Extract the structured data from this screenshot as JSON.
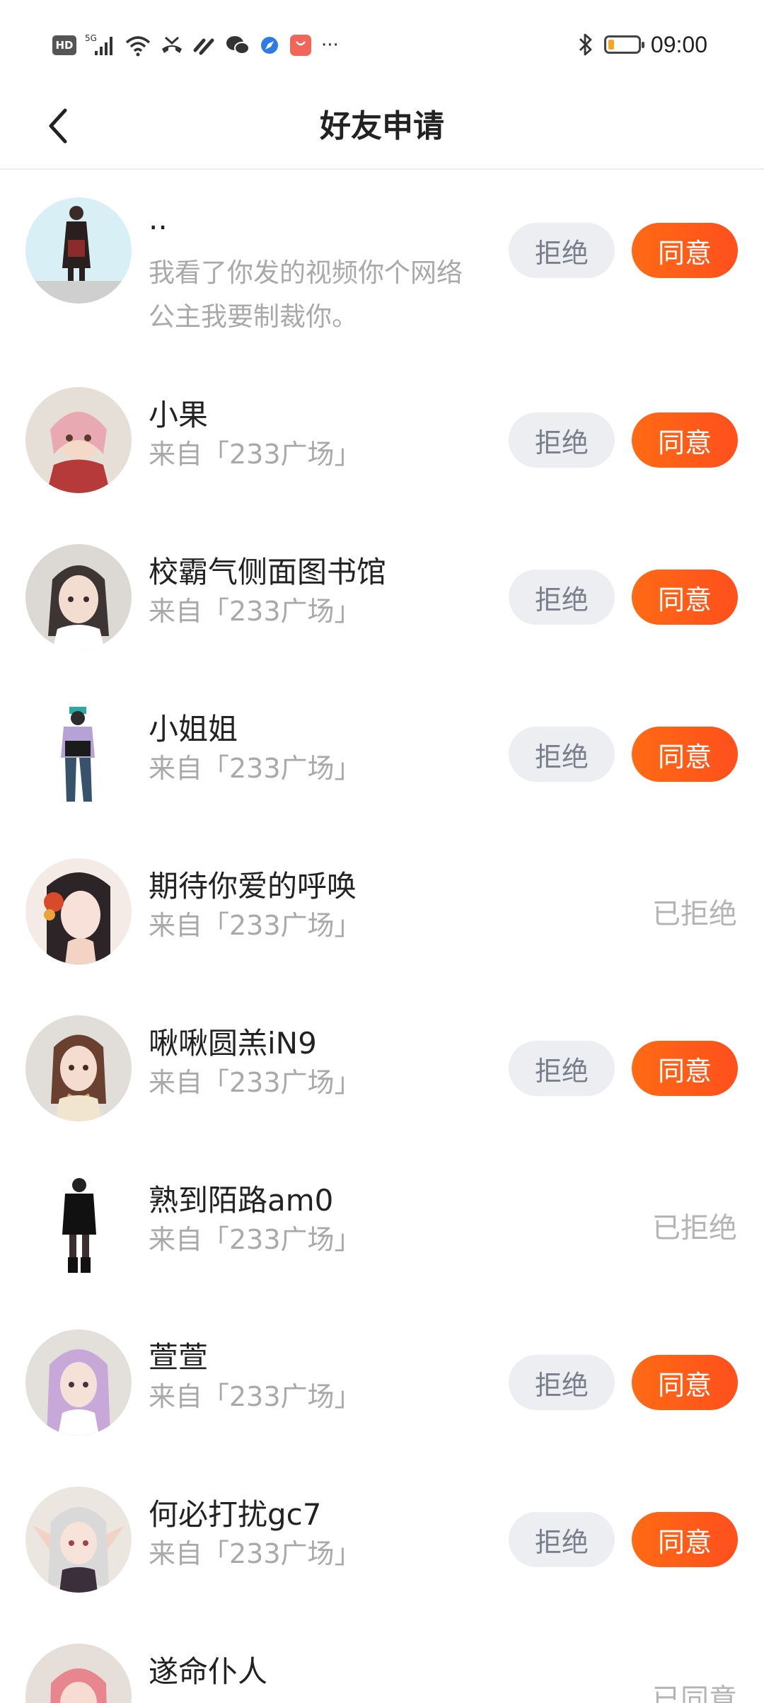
{
  "status_bar": {
    "time": "09:00",
    "left_icons": [
      "hd-icon",
      "signal-5g-icon",
      "wifi-icon",
      "missed-call-icon",
      "link-icon",
      "wechat-icon",
      "browser-icon",
      "shopping-icon",
      "more-dots-icon"
    ],
    "hd_label": "HD",
    "net_label": "5G",
    "dots": "···",
    "battery_level": 0.2
  },
  "header": {
    "back_icon": "chevron-left-icon",
    "title": "好友申请"
  },
  "labels": {
    "reject": "拒绝",
    "accept": "同意",
    "rejected": "已拒绝"
  },
  "requests": [
    {
      "name": "..",
      "message_line1": "我看了你发的视频你个网络",
      "message_line2": "公主我要制裁你。",
      "status": "pending"
    },
    {
      "name": "小果",
      "source": "来自「233广场」",
      "status": "pending"
    },
    {
      "name": "校霸气侧面图书馆",
      "source": "来自「233广场」",
      "status": "pending"
    },
    {
      "name": "小姐姐",
      "source": "来自「233广场」",
      "status": "pending"
    },
    {
      "name": "期待你爱的呼唤",
      "source": "来自「233广场」",
      "status": "rejected"
    },
    {
      "name": "啾啾圆羔iN9",
      "source": "来自「233广场」",
      "status": "pending"
    },
    {
      "name": "熟到陌路am0",
      "source": "来自「233广场」",
      "status": "rejected"
    },
    {
      "name": "萱萱",
      "source": "来自「233广场」",
      "status": "pending"
    },
    {
      "name": "何必打扰gc7",
      "source": "来自「233广场」",
      "status": "pending"
    },
    {
      "name": "遂命仆人",
      "status": "rejected",
      "status_text": "已同意"
    }
  ],
  "colors": {
    "accent": "#ff5a1a",
    "reject_bg": "#eceef2",
    "muted_text": "#a9a9ab"
  }
}
